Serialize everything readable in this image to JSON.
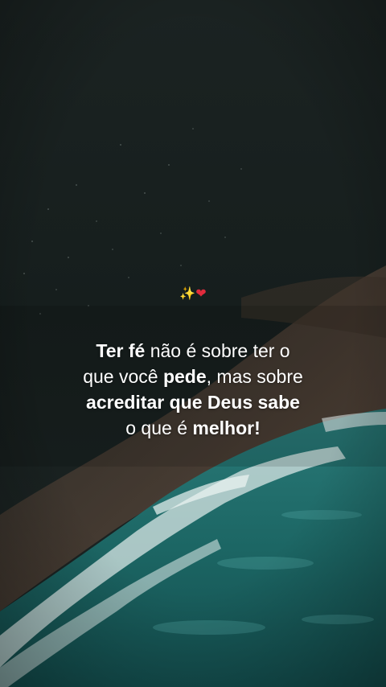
{
  "background": {
    "scene": "aerial-ocean-coastline",
    "colors": {
      "dark_sky": "#18201f",
      "rock": "#5a4a3c",
      "sea": "#1f6b6a",
      "foam": "#d8e6e4"
    }
  },
  "emoji": {
    "sparkles": "✨",
    "heart": "❤"
  },
  "quote": {
    "line1": {
      "bold": "Ter fé",
      "rest": " não é sobre ter o"
    },
    "line2": {
      "pre": "que você ",
      "bold": "pede",
      "rest": ", mas sobre"
    },
    "line3": {
      "bold": "acreditar que Deus sabe"
    },
    "line4": {
      "pre": "o que é ",
      "bold": "melhor!"
    }
  }
}
